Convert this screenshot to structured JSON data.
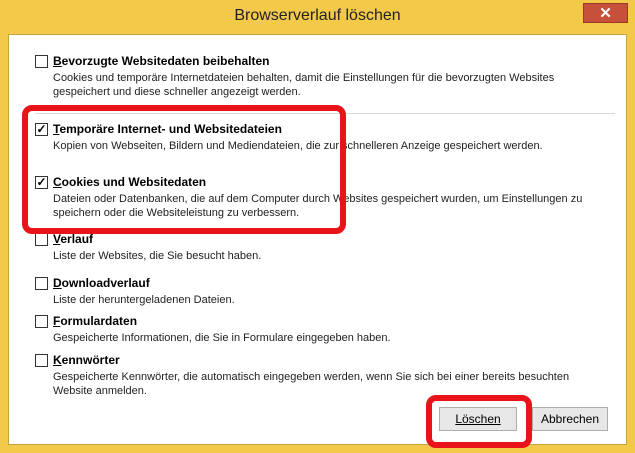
{
  "window": {
    "title": "Browserverlauf löschen",
    "close_label": "✕"
  },
  "options": [
    {
      "checked": false,
      "title_first": "B",
      "title_rest": "evorzugte Websitedaten beibehalten",
      "description": "Cookies und temporäre Internetdateien behalten, damit die Einstellungen für die bevorzugten Websites gespeichert und diese schneller angezeigt werden."
    },
    {
      "checked": true,
      "title_first": "T",
      "title_rest": "emporäre Internet- und Websitedateien",
      "description": "Kopien von Webseiten, Bildern und Mediendateien, die zur schnelleren Anzeige gespeichert werden."
    },
    {
      "checked": true,
      "title_first": "C",
      "title_rest": "ookies und Websitedaten",
      "description": "Dateien oder Datenbanken, die auf dem Computer durch Websites gespeichert wurden, um Einstellungen zu speichern oder die Websiteleistung zu verbessern."
    },
    {
      "checked": false,
      "title_first": "V",
      "title_rest": "erlauf",
      "description": "Liste der Websites, die Sie besucht haben."
    },
    {
      "checked": false,
      "title_first": "D",
      "title_rest": "ownloadverlauf",
      "description": "Liste der heruntergeladenen Dateien."
    },
    {
      "checked": false,
      "title_first": "F",
      "title_rest": "ormulardaten",
      "description": "Gespeicherte Informationen, die Sie in Formulare eingegeben haben."
    },
    {
      "checked": false,
      "title_first": "K",
      "title_rest": "ennwörter",
      "description": "Gespeicherte Kennwörter, die automatisch eingegeben werden, wenn Sie sich bei einer bereits besuchten Website anmelden."
    }
  ],
  "buttons": {
    "delete_label": "Löschen",
    "cancel_label": "Abbrechen"
  },
  "colors": {
    "titlebar": "#f3c94a",
    "close": "#c7503a",
    "highlight": "#e8141a"
  }
}
